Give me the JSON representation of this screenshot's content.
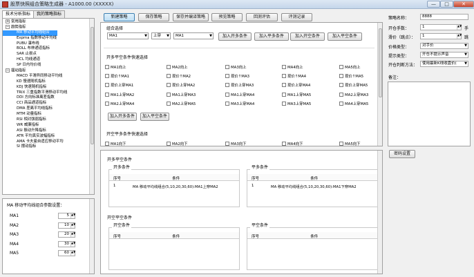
{
  "window": {
    "title": "股票快照组合策略生成器 - A1000.00 (XXXXX)",
    "minimize": "—",
    "maximize": "□",
    "close": "✕"
  },
  "left": {
    "tabs": [
      "技术分析指标",
      "我的策略指标"
    ],
    "tree": [
      {
        "label": "常用指标",
        "level": 0,
        "box": "+"
      },
      {
        "label": "趋势指标",
        "level": 0,
        "box": "−"
      },
      {
        "label": "MA 移动平均线组合",
        "level": 1,
        "selected": true
      },
      {
        "label": "Expma 指数移动平均线",
        "level": 1
      },
      {
        "label": "PUBU 瀑布线",
        "level": 1
      },
      {
        "label": "BOLL 布林通道指标",
        "level": 1
      },
      {
        "label": "SAR 止损点",
        "level": 1
      },
      {
        "label": "HCL 均线通道",
        "level": 1
      },
      {
        "label": "SP 日内均价线",
        "level": 1
      },
      {
        "label": "摆动指标",
        "level": 0,
        "box": "−"
      },
      {
        "label": "MACD 平滑异同移动平均线",
        "level": 1
      },
      {
        "label": "KD 慢速随机指标",
        "level": 1
      },
      {
        "label": "KDJ 快速随机指标",
        "level": 1
      },
      {
        "label": "TRIX 三重指数平滑移动平均线",
        "level": 1
      },
      {
        "label": "DDI 方向标准离差指数",
        "level": 1
      },
      {
        "label": "CCI 商品通道指标",
        "level": 1
      },
      {
        "label": "DMA 差离平均线指标",
        "level": 1
      },
      {
        "label": "MTM 动量指标",
        "level": 1
      },
      {
        "label": "RSI 相对强弱指标",
        "level": 1
      },
      {
        "label": "WR 威廉指标",
        "level": 1
      },
      {
        "label": "ASI 振动升降指标",
        "level": 1
      },
      {
        "label": "ATR 平均真实波幅指标",
        "level": 1
      },
      {
        "label": "AMA 卡夫曼自适应移动平均",
        "level": 1
      },
      {
        "label": "SI 摆动指标",
        "level": 1
      }
    ],
    "param_title": "MA 移动平均线组合参数设置：",
    "params": [
      {
        "name": "MA1",
        "value": "5"
      },
      {
        "name": "MA2",
        "value": "10"
      },
      {
        "name": "MA3",
        "value": "20"
      },
      {
        "name": "MA4",
        "value": "30"
      },
      {
        "name": "MA5",
        "value": "60"
      }
    ]
  },
  "toolbar": [
    "新建策略",
    "保存策略",
    "保存并编译策略",
    "预览策略",
    "回测评估",
    "评测记录"
  ],
  "cond": {
    "title": "组合选择",
    "sel1": "MA1",
    "sel2": "上穿",
    "sel3": "MA1",
    "add_buttons": [
      "加入开多条件",
      "加入平多条件",
      "加入开空条件",
      "加入平空条件"
    ],
    "group1_title": "开多平空条件快速选择",
    "checks": [
      [
        "MA1向上",
        "MA2向上",
        "MA3向上",
        "MA4向上",
        "MA5向上"
      ],
      [
        "现价↑MA1",
        "现价↑MA2",
        "现价↑MA3",
        "现价↑MA4",
        "现价↑MA5"
      ],
      [
        "现价上穿MA1",
        "现价上穿MA2",
        "现价上穿MA3",
        "现价上穿MA4",
        "现价上穿MA5"
      ],
      [
        "MA1上穿MA2",
        "MA1上穿MA3",
        "MA1上穿MA4",
        "MA1上穿MA5",
        "MA2上穿MA3"
      ],
      [
        "MA2上穿MA4",
        "MA2上穿MA5",
        "MA3上穿MA4",
        "MA3上穿MA5",
        "MA4上穿MA5"
      ]
    ],
    "group1_buttons": [
      "加入开多条件",
      "加入平空条件"
    ],
    "group2_title": "开空平多条件快速选择",
    "checks2": [
      "MA1向下",
      "MA2向下",
      "MA3向下",
      "MA4向下",
      "MA5向下"
    ]
  },
  "summary": {
    "title": "开多平空条件",
    "tables": [
      {
        "title": "开多条件",
        "cols": [
          "序号",
          "条件"
        ],
        "rows": [
          [
            "1",
            "MA 移动平均线组合(5,10,20,30,60):MA1上穿MA2"
          ]
        ]
      },
      {
        "title": "平多条件",
        "cols": [
          "序号",
          "条件"
        ],
        "rows": [
          [
            "1",
            "MA 移动平均线组合(5,10,20,30,60):MA1下穿MA2"
          ]
        ]
      }
    ],
    "title2": "开空平空条件",
    "tables2": [
      {
        "title": "开空条件",
        "cols": [
          "序号",
          "条件"
        ],
        "rows": []
      },
      {
        "title": "平空条件",
        "cols": [
          "序号",
          "条件"
        ],
        "rows": []
      }
    ]
  },
  "right": {
    "fields": [
      {
        "label": "策略名称：",
        "value": "8888",
        "type": "text"
      },
      {
        "label": "开仓手数：",
        "value": "1",
        "type": "spin",
        "unit": "手"
      },
      {
        "label": "滑价（跳点）：",
        "value": "1",
        "type": "spin",
        "unit": "跳"
      },
      {
        "label": "价格类型：",
        "value": "对手价",
        "type": "select"
      },
      {
        "label": "提示类型：",
        "value": "开仓不提示声音",
        "type": "select"
      },
      {
        "label": "开仓判断方法：",
        "value": "使用最新K线收盘价(",
        "type": "select"
      }
    ],
    "note_label": "备注：",
    "password_btn": "密码设置"
  }
}
